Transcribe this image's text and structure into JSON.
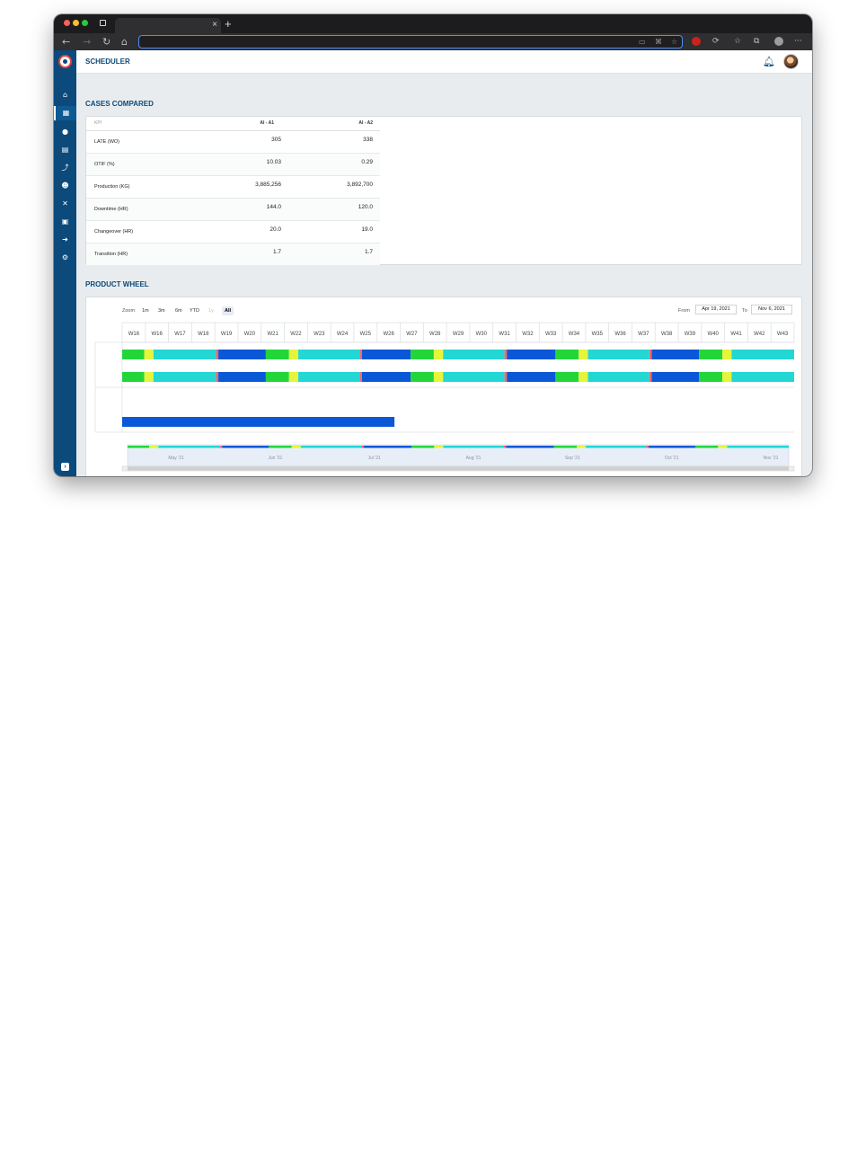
{
  "browser": {
    "tab_close": "×",
    "new_tab": "+",
    "toolbar_icons": [
      "back-icon",
      "forward-icon",
      "reload-icon",
      "home-icon"
    ],
    "more": "···"
  },
  "app": {
    "title": "SCHEDULER"
  },
  "sidebar": {
    "items": [
      "home-icon",
      "calendar-icon",
      "clock-icon",
      "document-icon",
      "chart-icon",
      "users-icon",
      "tools-icon",
      "calculator-icon",
      "sign-in-icon",
      "settings-icon"
    ],
    "active_index": 1
  },
  "cases": {
    "title": "CASES COMPARED",
    "columns": [
      "KPI",
      "AI - A1",
      "AI - A2"
    ],
    "rows": [
      {
        "kpi": "LATE (WO)",
        "a1": "305",
        "a2": "338"
      },
      {
        "kpi": "OTIF (%)",
        "a1": "10.03",
        "a2": "0.29"
      },
      {
        "kpi": "Production (KG)",
        "a1": "3,885,256",
        "a2": "3,892,700"
      },
      {
        "kpi": "Downtime (HR)",
        "a1": "144.0",
        "a2": "120.0"
      },
      {
        "kpi": "Changeover (HR)",
        "a1": "20.0",
        "a2": "19.0"
      },
      {
        "kpi": "Transition (HR)",
        "a1": "1.7",
        "a2": "1.7"
      }
    ]
  },
  "wheel": {
    "title": "PRODUCT WHEEL",
    "zoom_label": "Zoom",
    "zoom_options": [
      "1m",
      "3m",
      "6m",
      "YTD",
      "1y",
      "All"
    ],
    "zoom_selected": "All",
    "zoom_disabled": [
      "1y"
    ],
    "from_label": "From",
    "from_value": "Apr 19, 2021",
    "to_label": "To",
    "to_value": "Nov 6, 2021"
  },
  "colors": {
    "blue": "#0a58d8",
    "green": "#22d63a",
    "yellow": "#e4f53c",
    "cyan": "#23d7d4",
    "red": "#f26a6a"
  },
  "chart_data": {
    "type": "gantt",
    "week_labels": [
      "W16",
      "W16",
      "W17",
      "W18",
      "W19",
      "W20",
      "W21",
      "W22",
      "W23",
      "W24",
      "W25",
      "W26",
      "W27",
      "W28",
      "W29",
      "W30",
      "W31",
      "W32",
      "W33",
      "W34",
      "W35",
      "W36",
      "W37",
      "W38",
      "W39",
      "W40",
      "W41",
      "W42",
      "W43"
    ],
    "x_range": [
      0,
      29
    ],
    "rows": [
      {
        "segments": [
          {
            "start": 0,
            "end": 0.95,
            "color": "green"
          },
          {
            "start": 0.95,
            "end": 1.35,
            "color": "yellow"
          },
          {
            "start": 1.35,
            "end": 4.05,
            "color": "cyan"
          },
          {
            "start": 4.05,
            "end": 4.15,
            "color": "red"
          },
          {
            "start": 4.15,
            "end": 6.2,
            "color": "blue"
          },
          {
            "start": 6.2,
            "end": 7.2,
            "color": "green"
          },
          {
            "start": 7.2,
            "end": 7.6,
            "color": "yellow"
          },
          {
            "start": 7.6,
            "end": 10.25,
            "color": "cyan"
          },
          {
            "start": 10.25,
            "end": 10.35,
            "color": "red"
          },
          {
            "start": 10.35,
            "end": 12.45,
            "color": "blue"
          },
          {
            "start": 12.45,
            "end": 13.45,
            "color": "green"
          },
          {
            "start": 13.45,
            "end": 13.85,
            "color": "yellow"
          },
          {
            "start": 13.85,
            "end": 16.5,
            "color": "cyan"
          },
          {
            "start": 16.5,
            "end": 16.6,
            "color": "red"
          },
          {
            "start": 16.6,
            "end": 18.7,
            "color": "blue"
          },
          {
            "start": 18.7,
            "end": 19.7,
            "color": "green"
          },
          {
            "start": 19.7,
            "end": 20.1,
            "color": "yellow"
          },
          {
            "start": 20.1,
            "end": 22.75,
            "color": "cyan"
          },
          {
            "start": 22.75,
            "end": 22.85,
            "color": "red"
          },
          {
            "start": 22.85,
            "end": 24.9,
            "color": "blue"
          },
          {
            "start": 24.9,
            "end": 25.9,
            "color": "green"
          },
          {
            "start": 25.9,
            "end": 26.3,
            "color": "yellow"
          },
          {
            "start": 26.3,
            "end": 29,
            "color": "cyan"
          }
        ]
      },
      {
        "segments": [
          {
            "start": 0,
            "end": 0.95,
            "color": "green"
          },
          {
            "start": 0.95,
            "end": 1.35,
            "color": "yellow"
          },
          {
            "start": 1.35,
            "end": 4.05,
            "color": "cyan"
          },
          {
            "start": 4.05,
            "end": 4.15,
            "color": "red"
          },
          {
            "start": 4.15,
            "end": 6.2,
            "color": "blue"
          },
          {
            "start": 6.2,
            "end": 7.2,
            "color": "green"
          },
          {
            "start": 7.2,
            "end": 7.6,
            "color": "yellow"
          },
          {
            "start": 7.6,
            "end": 10.25,
            "color": "cyan"
          },
          {
            "start": 10.25,
            "end": 10.35,
            "color": "red"
          },
          {
            "start": 10.35,
            "end": 12.45,
            "color": "blue"
          },
          {
            "start": 12.45,
            "end": 13.45,
            "color": "green"
          },
          {
            "start": 13.45,
            "end": 13.85,
            "color": "yellow"
          },
          {
            "start": 13.85,
            "end": 16.5,
            "color": "cyan"
          },
          {
            "start": 16.5,
            "end": 16.6,
            "color": "red"
          },
          {
            "start": 16.6,
            "end": 18.7,
            "color": "blue"
          },
          {
            "start": 18.7,
            "end": 19.7,
            "color": "green"
          },
          {
            "start": 19.7,
            "end": 20.1,
            "color": "yellow"
          },
          {
            "start": 20.1,
            "end": 22.75,
            "color": "cyan"
          },
          {
            "start": 22.75,
            "end": 22.85,
            "color": "red"
          },
          {
            "start": 22.85,
            "end": 24.9,
            "color": "blue"
          },
          {
            "start": 24.9,
            "end": 25.9,
            "color": "green"
          },
          {
            "start": 25.9,
            "end": 26.3,
            "color": "yellow"
          },
          {
            "start": 26.3,
            "end": 29,
            "color": "cyan"
          }
        ]
      },
      {
        "segments": []
      },
      {
        "segments": [
          {
            "start": 0,
            "end": 11.75,
            "color": "blue"
          }
        ]
      }
    ],
    "navigator_labels": [
      "May '21",
      "Jun '21",
      "Jul '21",
      "Aug '21",
      "Sep '21",
      "Oct '21",
      "Nov '21"
    ]
  }
}
